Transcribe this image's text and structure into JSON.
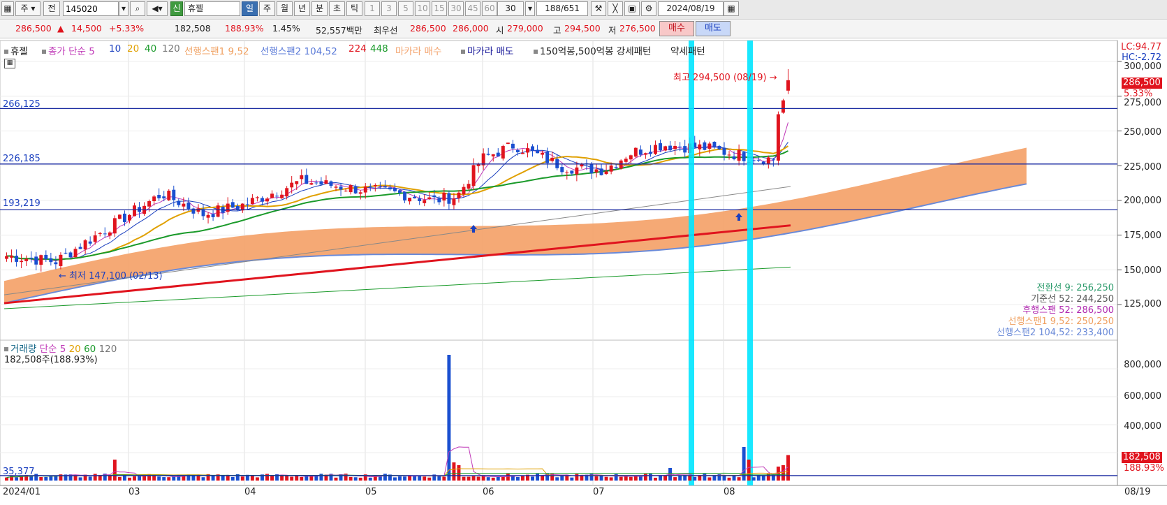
{
  "toolbar": {
    "type_label": "주",
    "prev_label": "전",
    "stock_code": "145020",
    "new_badge": "신",
    "stock_name": "휴젤",
    "periods": [
      "일",
      "주",
      "월",
      "년",
      "분",
      "초",
      "틱"
    ],
    "active_period": "일",
    "intervals": [
      "1",
      "3",
      "5",
      "10",
      "15",
      "30",
      "45",
      "60"
    ],
    "interval_value": "30",
    "page_counter": "188",
    "page_total": "/651",
    "date": "2024/08/19"
  },
  "quote": {
    "price": "286,500",
    "change_arrow": "▲",
    "change": "14,500",
    "change_pct": "+5.33%",
    "volume": "182,508",
    "volume_ratio": "188.93%",
    "turnover": "1.45%",
    "amount": "52,557백만",
    "best_label": "최우선",
    "best_ask": "286,500",
    "best_bid": "286,000",
    "open_label": "시",
    "open": "279,000",
    "high_label": "고",
    "high": "294,500",
    "low_label": "저",
    "low": "276,500",
    "buy_label": "매수",
    "sell_label": "매도"
  },
  "legend": {
    "stock": "휴젤",
    "ma_label": "종가 단순 5",
    "ma10": "10",
    "ma20": "20",
    "ma40": "40",
    "ma120": "120",
    "span1": "선행스팬1 9,52",
    "span2": "선행스팬2 104,52",
    "ma224": "224",
    "ma448": "448",
    "marubozu_buy": "마카라 매수",
    "marubozu_sell": "마카라 매도",
    "pattern": "150억봉,500억봉 강세패턴",
    "weak": "약세패턴"
  },
  "lc_hc": {
    "lc": "LC:94.77",
    "hc": "HC:-2.72"
  },
  "price_axis": [
    "300,000",
    "275,000",
    "250,000",
    "225,000",
    "200,000",
    "175,000",
    "150,000",
    "125,000"
  ],
  "volume_axis": [
    "800,000",
    "600,000",
    "400,000"
  ],
  "levels": {
    "l1": "266,125",
    "l2": "226,185",
    "l3": "193,219"
  },
  "annotations": {
    "high": "최고 294,500 (08/19)",
    "low": "최저 147,100 (02/13)",
    "price_badge": "286,500",
    "pct_badge": "5.33%",
    "vol_badge": "182,508",
    "vol_pct_badge": "188.93%",
    "vol_level": "35,377"
  },
  "ichimoku": [
    {
      "text": "전환선 9: 256,250",
      "color": "#2a9a6a"
    },
    {
      "text": "기준선 52: 244,250",
      "color": "#555555"
    },
    {
      "text": "후행스팬 52: 286,500",
      "color": "#b02ab0"
    },
    {
      "text": "선행스팬1 9,52: 250,250",
      "color": "#f0a060"
    },
    {
      "text": "선행스팬2 104,52: 233,400",
      "color": "#6a8ad8"
    }
  ],
  "volume_legend": {
    "label": "거래량",
    "ma_label": "단순 5",
    "ma20": "20",
    "ma60": "60",
    "ma120": "120",
    "summary": "182,508주(188.93%)"
  },
  "months": [
    "2024/01",
    "03",
    "04",
    "05",
    "06",
    "07",
    "08"
  ],
  "end_date": "08/19",
  "colors": {
    "up": "#e0141e",
    "down": "#1a4fd0",
    "cloud": "#f4a46e",
    "marker": "#00e5ff"
  }
}
